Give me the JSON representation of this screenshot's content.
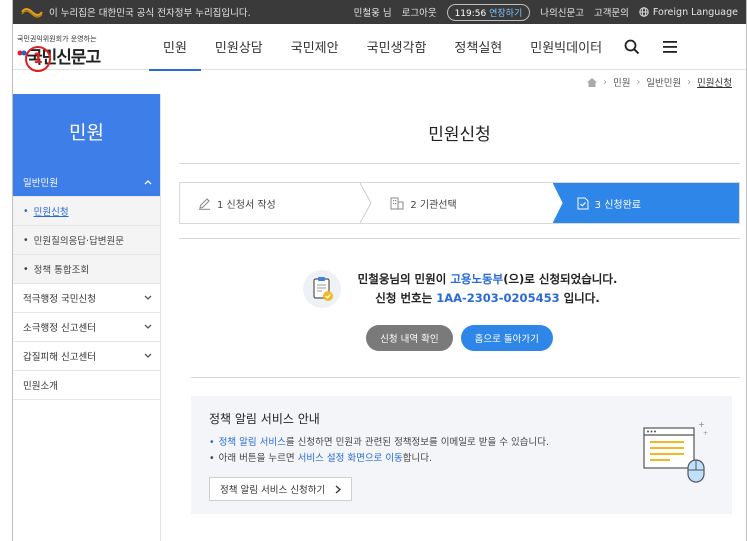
{
  "gov_bar": {
    "notice": "이 누리집은 대한민국 공식 전자정부 누리집입니다.",
    "user": "민철웅 님",
    "logout": "로그아웃",
    "timer": "119:56",
    "extend": "연장하기",
    "my_page": "나의신문고",
    "customer": "고객문의",
    "foreign": "Foreign Language"
  },
  "brand": {
    "sub": "국민권익위원회가 운영하는",
    "main": "국민신문고",
    "marker": "1"
  },
  "nav": [
    {
      "label": "민원",
      "active": true
    },
    {
      "label": "민원상담"
    },
    {
      "label": "국민제안"
    },
    {
      "label": "국민생각함"
    },
    {
      "label": "정책실현"
    },
    {
      "label": "민원빅데이터"
    }
  ],
  "breadcrumb": [
    "민원",
    "일반민원",
    "민원신청"
  ],
  "sidebar": {
    "title": "민원",
    "items": [
      {
        "label": "일반민원",
        "type": "open"
      },
      {
        "label": "민원신청",
        "type": "sub-active"
      },
      {
        "label": "민원질의응답·답변원문",
        "type": "sub"
      },
      {
        "label": "정책 통합조회",
        "type": "sub"
      },
      {
        "label": "적극행정 국민신청",
        "type": "item"
      },
      {
        "label": "소극행정 신고센터",
        "type": "item"
      },
      {
        "label": "갑질피해 신고센터",
        "type": "item"
      },
      {
        "label": "민원소개",
        "type": "plain"
      }
    ]
  },
  "main": {
    "title": "민원신청",
    "steps": [
      {
        "label": "1 신청서 작성"
      },
      {
        "label": "2 기관선택"
      },
      {
        "label": "3 신청완료",
        "active": true
      }
    ],
    "complete": {
      "line1_a": "민철웅님의 민원이 ",
      "agency": "고용노동부",
      "line1_b": "(으)로 신청되었습니다.",
      "line2_a": "신청 번호는 ",
      "number": "1AA-2303-0205453",
      "line2_b": " 입니다."
    },
    "btn_check": "신청 내역 확인",
    "btn_home": "홈으로 돌아가기",
    "info": {
      "title": "정책 알림 서비스 안내",
      "line1_link": "정책 알림 서비스",
      "line1_rest": "를 신청하면 민원과 관련된 정책정보를 이메일로 받을 수 있습니다.",
      "line2_a": "아래 버튼을 누르면 ",
      "line2_link": "서비스 설정 화면으로 이동",
      "line2_b": "합니다.",
      "button": "정책 알림 서비스 신청하기"
    }
  }
}
